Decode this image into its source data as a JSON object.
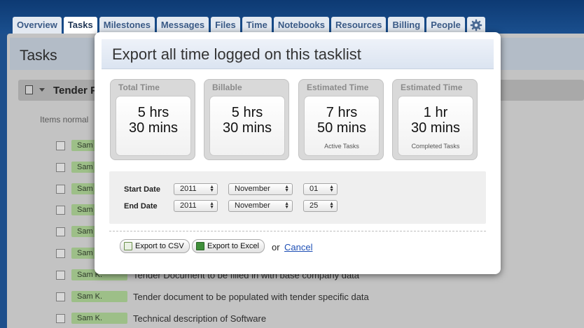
{
  "nav": {
    "tabs": [
      {
        "label": "Overview"
      },
      {
        "label": "Tasks"
      },
      {
        "label": "Milestones"
      },
      {
        "label": "Messages"
      },
      {
        "label": "Files"
      },
      {
        "label": "Time"
      },
      {
        "label": "Notebooks"
      },
      {
        "label": "Resources"
      },
      {
        "label": "Billing"
      },
      {
        "label": "People"
      }
    ],
    "active_tab": "Tasks",
    "settings_icon": "gear-icon"
  },
  "page": {
    "title": "Tasks",
    "tasklist_name": "Tender P",
    "items_note": "Items normal",
    "tasks": [
      {
        "assignee": "Sam",
        "text": ""
      },
      {
        "assignee": "Sam",
        "text": ""
      },
      {
        "assignee": "Sam",
        "text": ""
      },
      {
        "assignee": "Sam",
        "text": ""
      },
      {
        "assignee": "Sam",
        "text": ""
      },
      {
        "assignee": "Sam",
        "text": ""
      },
      {
        "assignee": "Sam K.",
        "text": "Tender Document to be filled in with base company data"
      },
      {
        "assignee": "Sam K.",
        "text": "Tender document to be populated with tender specific data"
      },
      {
        "assignee": "Sam K.",
        "text": "Technical description of Software"
      }
    ]
  },
  "modal": {
    "title": "Export all time logged on this tasklist",
    "stats": [
      {
        "label": "Total Time",
        "value": "5 hrs\n30 mins",
        "sub": ""
      },
      {
        "label": "Billable",
        "value": "5 hrs\n30 mins",
        "sub": ""
      },
      {
        "label": "Estimated Time",
        "value": "7 hrs\n50 mins",
        "sub": "Active Tasks"
      },
      {
        "label": "Estimated Time",
        "value": "1 hr\n30 mins",
        "sub": "Completed Tasks"
      }
    ],
    "start_date": {
      "label": "Start Date",
      "year": "2011",
      "month": "November",
      "day": "01"
    },
    "end_date": {
      "label": "End Date",
      "year": "2011",
      "month": "November",
      "day": "25"
    },
    "export_csv_label": "Export to CSV",
    "export_excel_label": "Export to Excel",
    "or_text": "or",
    "cancel_label": "Cancel",
    "colors": {
      "link": "#1e4fb5",
      "header_bg": "#dbe4f1",
      "nav_bg": "#1a4f8e"
    }
  }
}
